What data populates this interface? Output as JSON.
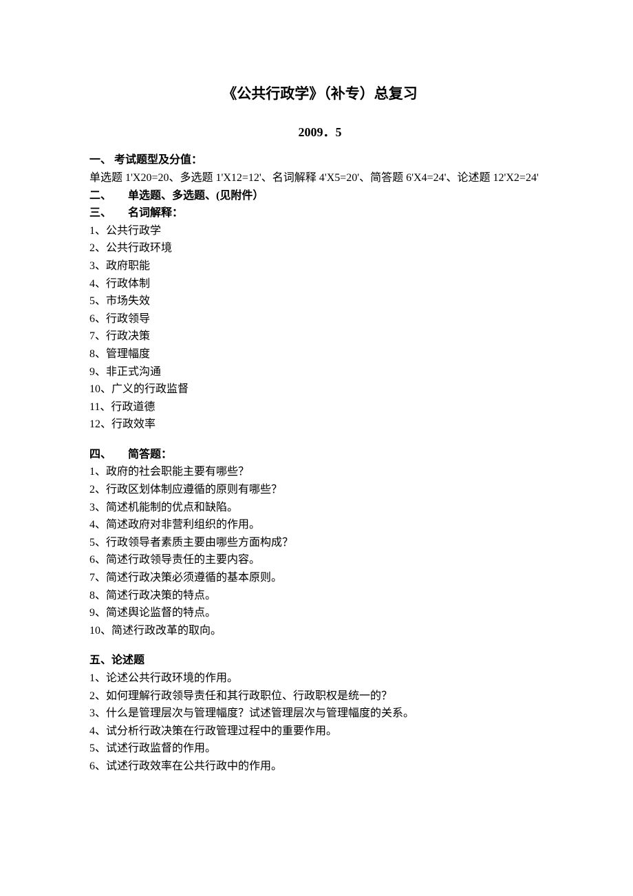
{
  "title": "《公共行政学》（补专）总复习",
  "subtitle": "2009．5",
  "sections": {
    "s1": {
      "head": "一、 考试题型及分值：",
      "body": "单选题 1'X20=20、多选题 1'X12=12'、名词解释 4'X5=20'、简答题 6'X4=24'、论述题 12'X2=24'"
    },
    "s2": {
      "head": "二、　　单选题、多选题、(见附件）"
    },
    "s3": {
      "head": "三、　　名词解释：",
      "items": [
        "1、公共行政学",
        "2、公共行政环境",
        "3、政府职能",
        "4、行政体制",
        "5、市场失效",
        "6、行政领导",
        "7、行政决策",
        "8、管理幅度",
        "9、非正式沟通",
        "10、广义的行政监督",
        "11、行政道德",
        "12、行政效率"
      ]
    },
    "s4": {
      "head": "四、　　简答题：",
      "items": [
        "1、政府的社会职能主要有哪些？",
        "2、行政区划体制应遵循的原则有哪些？",
        "3、简述机能制的优点和缺陷。",
        "4、简述政府对非营利组织的作用。",
        "5、行政领导者素质主要由哪些方面构成？",
        "6、简述行政领导责任的主要内容。",
        "7、简述行政决策必须遵循的基本原则。",
        "8、简述行政决策的特点。",
        "9、简述舆论监督的特点。",
        "10、简述行政改革的取向。"
      ]
    },
    "s5": {
      "head": "五、论述题",
      "items": [
        "1、论述公共行政环境的作用。",
        "2、如何理解行政领导责任和其行政职位、行政职权是统一的？",
        "3、什么是管理层次与管理幅度？试述管理层次与管理幅度的关系。",
        "4、试分析行政决策在行政管理过程中的重要作用。",
        "5、试述行政监督的作用。",
        "6、试述行政效率在公共行政中的作用。"
      ]
    }
  }
}
